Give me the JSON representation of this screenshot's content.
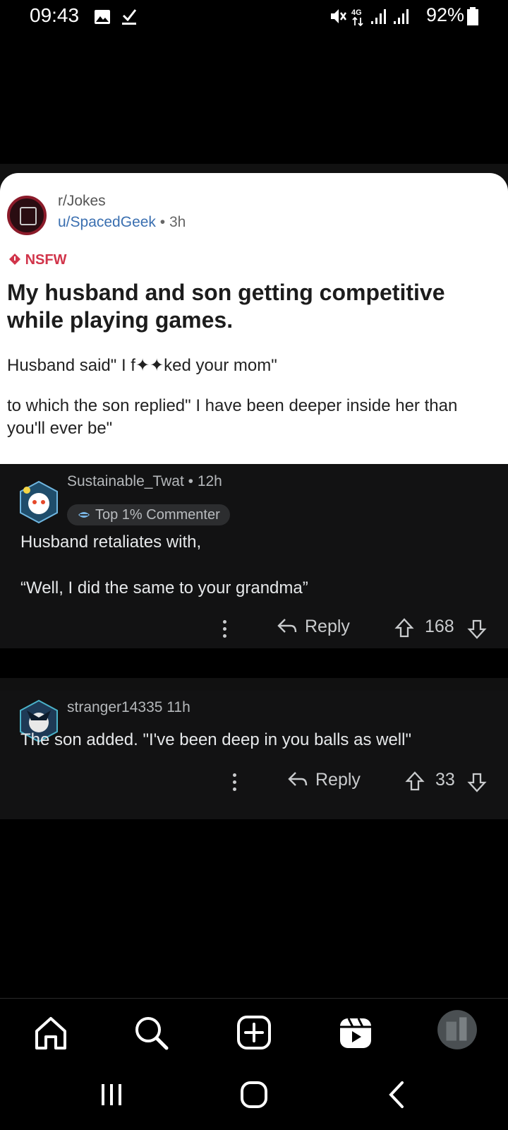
{
  "status_bar": {
    "time": "09:43",
    "battery": "92%",
    "icons": [
      "gallery-icon",
      "check-icon",
      "mute-icon",
      "4g-icon",
      "signal-icon",
      "signal-icon",
      "battery-icon"
    ]
  },
  "post": {
    "subreddit": "r/Jokes",
    "username": "u/SpacedGeek",
    "age": "3h",
    "nsfw_label": "NSFW",
    "title": "My husband and son getting competitive while playing games.",
    "body_line1": "Husband said\" I f✦✦ked your mom\"",
    "body_line2": "to which the son replied\" I have been deeper inside her than you'll ever be\""
  },
  "comments": [
    {
      "author": "Sustainable_Twat",
      "age": "12h",
      "badge": "Top 1% Commenter",
      "text_line1": "Husband retaliates with,",
      "text_line2": "“Well, I did the same to your grandma”",
      "reply_label": "Reply",
      "votes": "168"
    },
    {
      "author": "stranger14335",
      "age": "11h",
      "text": "The son added. \"I've been deep in you balls as well\"",
      "reply_label": "Reply",
      "votes": "33"
    }
  ],
  "nav": {
    "items": [
      "home-icon",
      "search-icon",
      "create-icon",
      "reels-icon",
      "profile-avatar"
    ]
  },
  "colors": {
    "background": "#000000",
    "comment_bg": "#121213",
    "nsfw": "#d1344a",
    "link": "#3a6fb0"
  }
}
